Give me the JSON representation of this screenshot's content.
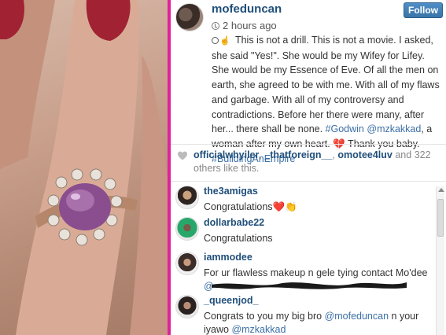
{
  "post": {
    "username": "mofeduncan",
    "follow_label": "Follow",
    "time": "2 hours ago",
    "caption_intro": " This is not a drill. This is not a movie. I asked, she said \"Yes!\". She would be my Wifey for Lifey. She would be my Essence of Eve. Of all the men on earth, she agreed to be with me. With all of my flaws and garbage. With all of my controversy and contradictions. Before her there were many, after her... there shall be none. ",
    "caption_tag1": "#Godwin",
    "caption_mention": "@mzkakkad",
    "caption_mid": ", a woman after my own heart. ",
    "caption_heart": "💔",
    "caption_end": " Thank you baby. ",
    "caption_tag2": "#BuildingAnEmpire"
  },
  "likes": {
    "user1": "officialwhyiler",
    "user2": "_thatforeign__",
    "user3": "omotee4luv",
    "and_text": " and ",
    "count": "322",
    "suffix": " others like this."
  },
  "comments": [
    {
      "user": "the3amigas",
      "text": "Congratulations❤️👏"
    },
    {
      "user": "dollarbabe22",
      "text": "Congratulations"
    },
    {
      "user": "iammodee",
      "text": "For ur flawless makeup n gele tying contact Mo'dee",
      "text2": "@"
    },
    {
      "user": "_queenjod_",
      "text_pre": "Congrats to you my big bro ",
      "mention1": "@mofeduncan",
      "text_mid": " n your iyawo ",
      "mention2": "@mzkakkad"
    }
  ],
  "colors": {
    "accent": "#e0219c",
    "link": "#1f4f7a",
    "mention": "#3b6fa6",
    "follow": "#3a74a8"
  }
}
